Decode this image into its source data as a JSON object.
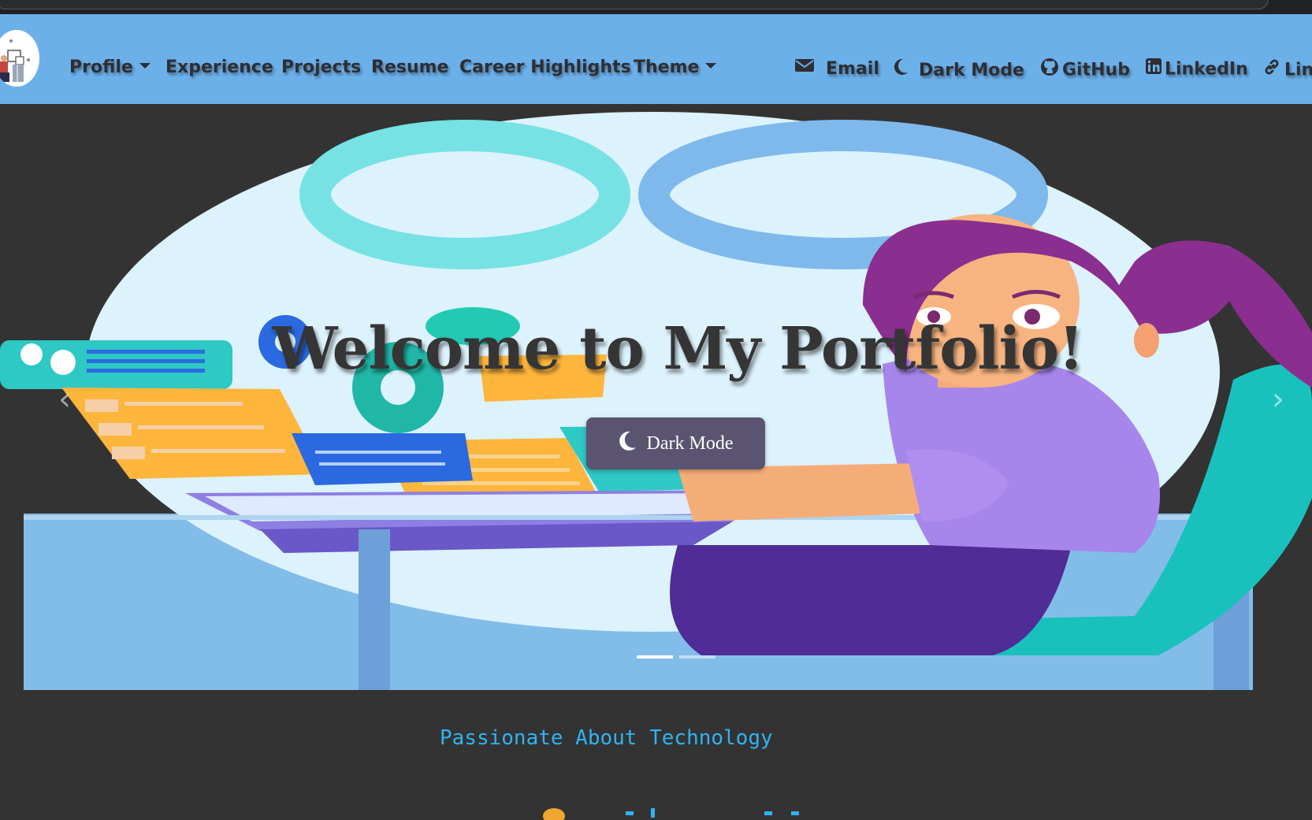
{
  "navbar": {
    "items": [
      {
        "label": "Profile",
        "dropdown": true
      },
      {
        "label": "Experience"
      },
      {
        "label": "Projects"
      },
      {
        "label": "Resume"
      },
      {
        "label": "Career Highlights"
      },
      {
        "label": "Theme",
        "dropdown": true
      }
    ],
    "right_items": [
      {
        "label": "Email",
        "icon": "envelope-icon"
      },
      {
        "label": "Dark Mode",
        "icon": "moon-icon"
      },
      {
        "label": "GitHub",
        "icon": "github-icon"
      },
      {
        "label": "LinkedIn",
        "icon": "linkedin-icon"
      },
      {
        "label": "Lin",
        "icon": "link-icon"
      }
    ]
  },
  "hero": {
    "title": "Welcome to My Portfolio!",
    "button_label": "Dark Mode",
    "button_icon": "moon-icon",
    "active_slide": 1,
    "slide_count": 2
  },
  "tagline": "Passionate About Technology",
  "colors": {
    "navbar_bg": "#6cb0ea",
    "page_bg": "#333333",
    "nav_text": "#2e2e33",
    "tagline": "#2fb4f2",
    "button_bg": "#5b5470"
  }
}
